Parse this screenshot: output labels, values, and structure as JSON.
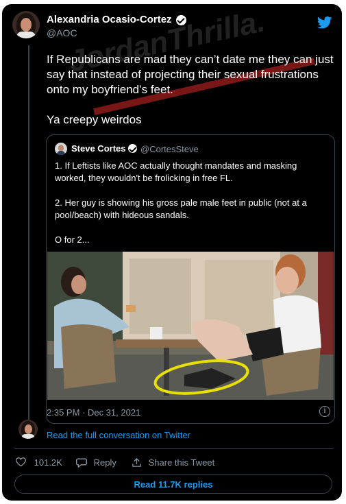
{
  "tweet": {
    "author_name": "Alexandria Ocasio-Cortez",
    "author_handle": "@AOC",
    "text": "If Republicans are mad they can’t date me they can just say that instead of projecting their sexual frustrations onto my boyfriend’s feet.\n\nYa creepy weirdos",
    "timestamp": "2:35 PM · Dec 31, 2021"
  },
  "quote": {
    "author_name": "Steve Cortes",
    "author_handle": "@CortesSteve",
    "paragraphs": [
      "1. If Leftists like AOC actually thought mandates and masking worked, they wouldn't be frolicking in free FL.",
      "2. Her guy is showing his gross pale male feet in public (not at a pool/beach) with hideous sandals.",
      "O for 2..."
    ]
  },
  "conversation_link": "Read the full conversation on Twitter",
  "actions": {
    "likes": "101.2K",
    "reply_label": "Reply",
    "share_label": "Share this Tweet"
  },
  "read_replies": "Read 11.7K replies",
  "watermark": "JordanThrilla.",
  "colors": {
    "accent": "#1d9bf0",
    "background": "#000000",
    "muted": "#8b98a5",
    "border": "#38444d",
    "highlight": "#e8e000"
  }
}
